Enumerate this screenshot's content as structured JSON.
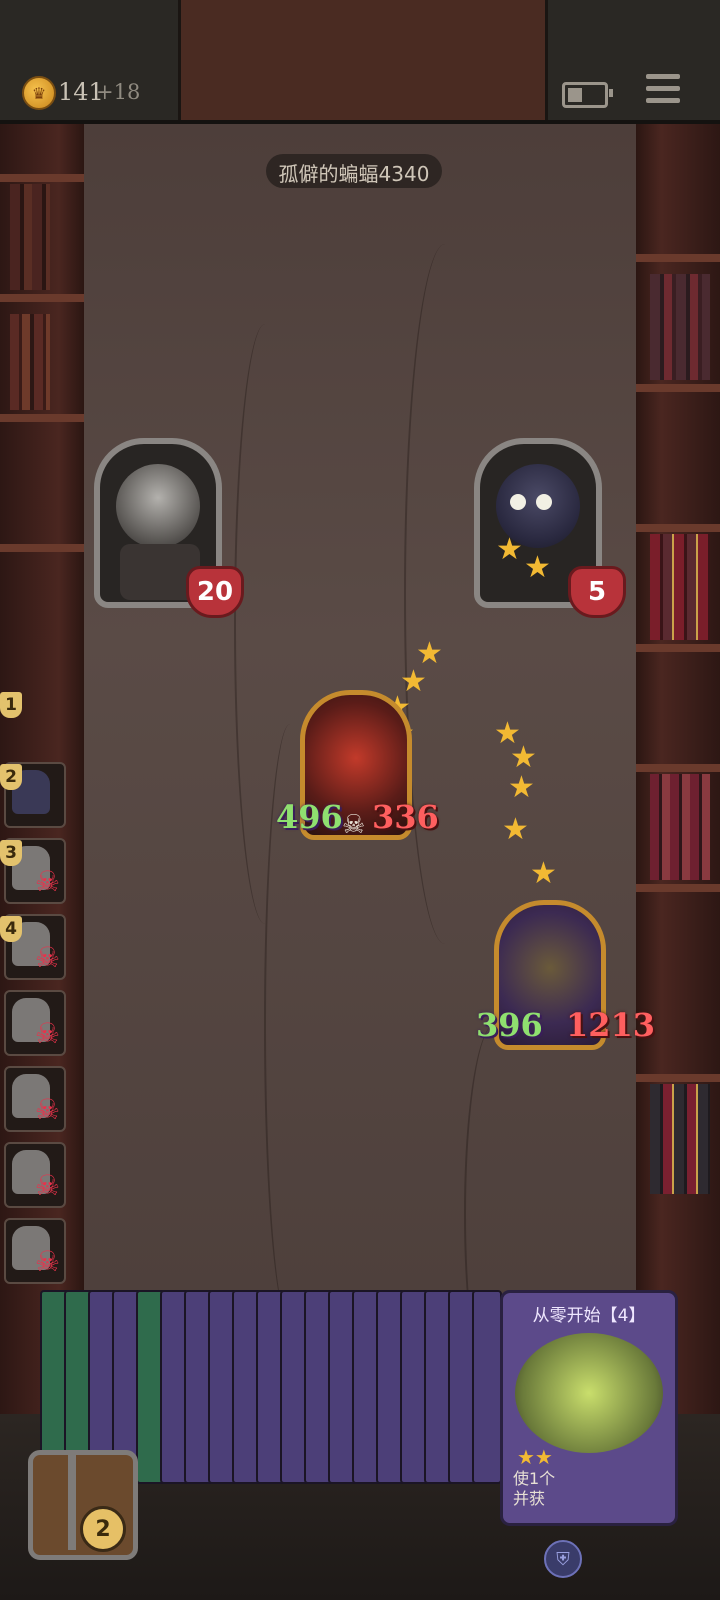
{
  "header": {
    "gold": "141",
    "gold_increment": "+18",
    "gold_icon": "crown-coin-icon",
    "battery_icon": "battery-icon",
    "menu_icon": "hamburger-menu-icon"
  },
  "opponent": {
    "name": "孤僻的蝙蝠4340"
  },
  "heroes": {
    "player": {
      "portrait": "cat-hero-portrait",
      "health": "20"
    },
    "opponent": {
      "portrait": "owl-hero-portrait",
      "health": "5"
    }
  },
  "units": [
    {
      "portrait": "red-dragon-unit",
      "attack": "496",
      "health": "336"
    },
    {
      "portrait": "witch-unit",
      "attack": "396",
      "health": "1213"
    }
  ],
  "roster": [
    {
      "rank": "1"
    },
    {
      "rank": "2",
      "eliminated": false
    },
    {
      "rank": "3",
      "eliminated": true
    },
    {
      "rank": "4",
      "eliminated": true
    },
    {
      "rank": "",
      "eliminated": true
    },
    {
      "rank": "",
      "eliminated": true
    },
    {
      "rank": "",
      "eliminated": true
    },
    {
      "rank": "",
      "eliminated": true
    }
  ],
  "hand_card": {
    "title": "从零开始【4】",
    "description": "使1个\n并获",
    "stars": 2
  },
  "chest": {
    "count": "2"
  },
  "colors": {
    "card_purple": "#5c4a8a",
    "card_green": "#2f6b4c",
    "gold_frame": "#c58b2d",
    "health_red": "#b8333a"
  }
}
